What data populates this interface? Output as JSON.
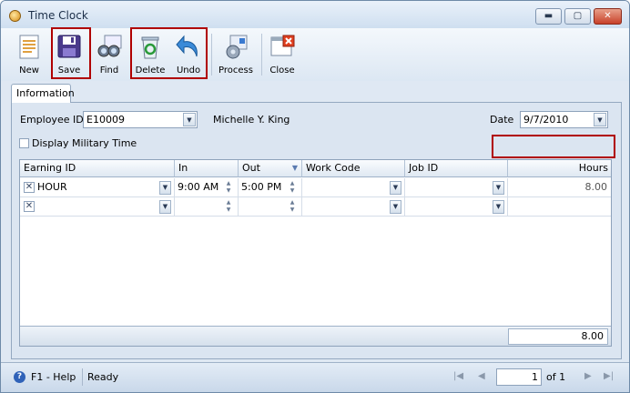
{
  "window": {
    "title": "Time Clock",
    "min_glyph": "▬",
    "max_glyph": "▢",
    "close_glyph": "✕"
  },
  "toolbar": {
    "new_label": "New",
    "save_label": "Save",
    "find_label": "Find",
    "delete_label": "Delete",
    "undo_label": "Undo",
    "process_label": "Process",
    "close_label": "Close"
  },
  "tabs": {
    "information": "Information"
  },
  "form": {
    "employee_id_label": "Employee ID",
    "employee_id_value": "E10009",
    "employee_name": "Michelle Y. King",
    "date_label": "Date",
    "date_value": "9/7/2010",
    "military_label": "Display Military Time"
  },
  "grid": {
    "columns": {
      "earning_id": "Earning ID",
      "in": "In",
      "out": "Out",
      "work_code": "Work Code",
      "job_id": "Job ID",
      "hours": "Hours"
    },
    "rows": [
      {
        "earning_id": "HOUR",
        "in": "9:00 AM",
        "out": "5:00 PM",
        "work_code": "",
        "job_id": "",
        "hours": "8.00"
      },
      {
        "earning_id": "",
        "in": "",
        "out": "",
        "work_code": "",
        "job_id": "",
        "hours": ""
      }
    ],
    "total_hours": "8.00"
  },
  "status": {
    "help_label": "F1 - Help",
    "status_text": "Ready",
    "page_current": "1",
    "page_of": "of 1"
  },
  "colors": {
    "highlight_box": "#b00000",
    "accent": "#2f62b8"
  }
}
